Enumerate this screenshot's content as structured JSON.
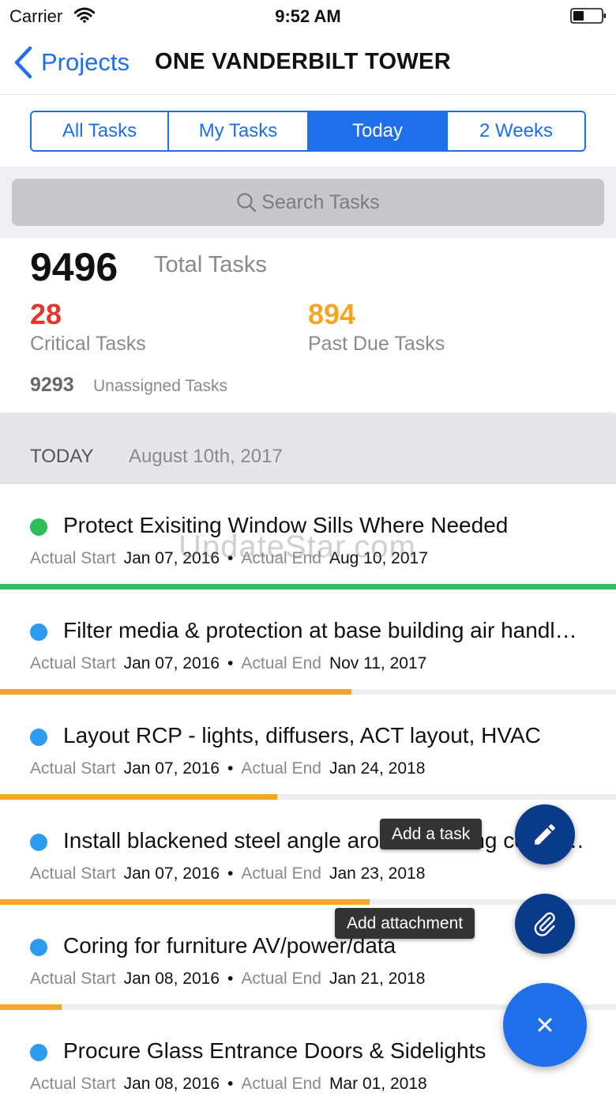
{
  "status_bar": {
    "carrier": "Carrier",
    "time": "9:52 AM",
    "wifi_icon": "wifi-icon",
    "battery_icon": "battery-icon"
  },
  "nav": {
    "back_label": "Projects",
    "title": "ONE VANDERBILT TOWER",
    "back_icon": "chevron-left-icon"
  },
  "tabs": [
    {
      "label": "All Tasks",
      "active": false
    },
    {
      "label": "My Tasks",
      "active": false
    },
    {
      "label": "Today",
      "active": true
    },
    {
      "label": "2 Weeks",
      "active": false
    }
  ],
  "search": {
    "placeholder": "Search Tasks"
  },
  "stats": {
    "total_count": "9496",
    "total_label": "Total Tasks",
    "critical_count": "28",
    "critical_label": "Critical Tasks",
    "pastdue_count": "894",
    "pastdue_label": "Past Due Tasks",
    "unassigned_count": "9293",
    "unassigned_label": "Unassigned Tasks"
  },
  "section": {
    "label": "TODAY",
    "date": "August 10th, 2017"
  },
  "meta_labels": {
    "start": "Actual Start",
    "end": "Actual End",
    "separator": "•"
  },
  "tasks": [
    {
      "title": "Protect Exisiting Window Sills Where Needed",
      "start": "Jan 07, 2016",
      "end": "Aug 10, 2017",
      "status_color": "#2dbe5a",
      "progress": 1.0,
      "progress_color": "#2dbe5a"
    },
    {
      "title": "Filter media & protection at base building air handlers",
      "start": "Jan 07, 2016",
      "end": "Nov 11, 2017",
      "status_color": "#2d9bf0",
      "progress": 0.57,
      "progress_color": "#f5a623"
    },
    {
      "title": "Layout RCP - lights, diffusers, ACT layout, HVAC",
      "start": "Jan 07, 2016",
      "end": "Jan 24, 2018",
      "status_color": "#2d9bf0",
      "progress": 0.45,
      "progress_color": "#f5a623"
    },
    {
      "title": "Install blackened steel angle around existing columns",
      "start": "Jan 07, 2016",
      "end": "Jan 23, 2018",
      "status_color": "#2d9bf0",
      "progress": 0.6,
      "progress_color": "#f5a623"
    },
    {
      "title": "Coring for furniture AV/power/data",
      "start": "Jan 08, 2016",
      "end": "Jan 21, 2018",
      "status_color": "#2d9bf0",
      "progress": 0.1,
      "progress_color": "#f5a623"
    },
    {
      "title": "Procure Glass Entrance Doors & Sidelights",
      "start": "Jan 08, 2016",
      "end": "Mar 01, 2018",
      "status_color": "#2d9bf0",
      "progress": 0,
      "progress_color": "#f5a623"
    }
  ],
  "watermark": "UpdateStar.com",
  "fab": {
    "add_task_label": "Add a task",
    "add_attachment_label": "Add attachment",
    "add_task_icon": "pencil-icon",
    "add_attachment_icon": "paperclip-icon",
    "close_icon": "close-icon"
  },
  "colors": {
    "accent": "#1f6fea",
    "critical": "#e8342a",
    "past_due": "#f5a623",
    "fab_dark": "#0a3a8a"
  }
}
